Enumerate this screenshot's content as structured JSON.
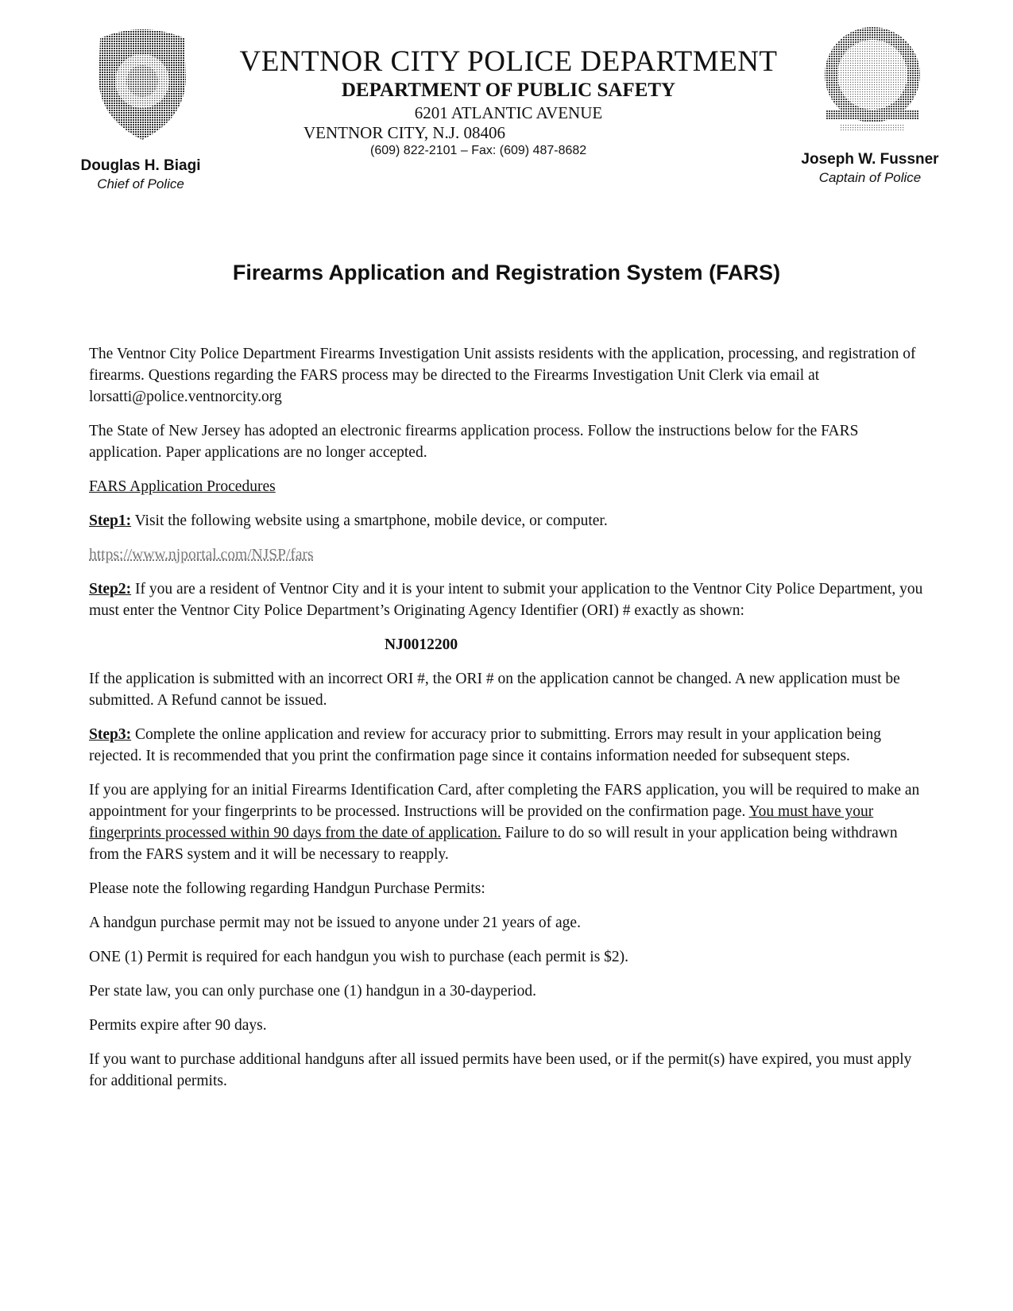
{
  "letterhead": {
    "title": "VENTNOR CITY POLICE DEPARTMENT",
    "subtitle": "DEPARTMENT OF PUBLIC SAFETY",
    "address_line1": "6201 ATLANTIC AVENUE",
    "address_line2": "VENTNOR CITY, N.J. 08406",
    "phone": "(609) 822-2101 – Fax: (609) 487-8682",
    "left_logo": "police-badge-icon",
    "right_logo": "police-seal-icon"
  },
  "officials": {
    "chief": {
      "name": "Douglas H. Biagi",
      "title": "Chief of Police"
    },
    "captain": {
      "name": "Joseph W. Fussner",
      "title": "Captain of Police"
    }
  },
  "document": {
    "title": "Firearms Application and Registration System (FARS)",
    "intro": "The Ventnor City Police Department Firearms Investigation Unit assists residents with the application, processing, and registration of firearms. Questions regarding the FARS process may be directed to the Firearms Investigation Unit Clerk via email at lorsatti@police.ventnorcity.org",
    "state_note": "The State of New Jersey has adopted an electronic firearms application process. Follow the instructions below for the FARS application.  Paper applications are no longer accepted.",
    "procedures_heading": "FARS Application Procedures",
    "step1": {
      "label": "Step1:",
      "text": " Visit the following website using a smartphone, mobile device, or computer."
    },
    "website": "https://www.njportal.com/NJSP/fars",
    "step2": {
      "label": "Step2:",
      "text": " If you are a resident of Ventnor City and it is your intent to submit your application to the Ventnor City Police Department, you must enter the Ventnor City Police Department’s Originating Agency Identifier (ORI) # exactly as shown:"
    },
    "ori_number": "NJ0012200",
    "ori_warning": "If the application is submitted with an incorrect ORI #, the ORI # on the application cannot be changed. A new application must be submitted. A Refund cannot be issued.",
    "step3": {
      "label": "Step3:",
      "text": " Complete the online application and review for accuracy prior to submitting. Errors may result in your application being rejected. It is recommended that you print the confirmation page since it contains information needed for subsequent steps."
    },
    "fid_text_before": "If you are applying for an initial Firearms Identification Card, after completing the FARS application, you will be required to make an appointment for your fingerprints to be processed. Instructions will be provided on the confirmation page. ",
    "fid_text_underlined": "You must have your fingerprints processed within 90 days from the date of application.",
    "fid_text_after": " Failure to do so will result in your application being withdrawn from the FARS system and it will be necessary to reapply.",
    "handgun_heading": "Please note the following regarding Handgun Purchase Permits:",
    "handgun_notes": [
      "A handgun purchase permit may not be issued to anyone under 21 years of age.",
      "ONE (1) Permit is required for each handgun you wish to purchase (each permit is $2).",
      "Per state law, you can only purchase one (1) handgun in a 30-dayperiod.",
      "Permits expire after 90 days.",
      "If you want to purchase additional handguns after all issued permits have been used, or if the permit(s) have expired, you must apply for additional permits."
    ]
  }
}
